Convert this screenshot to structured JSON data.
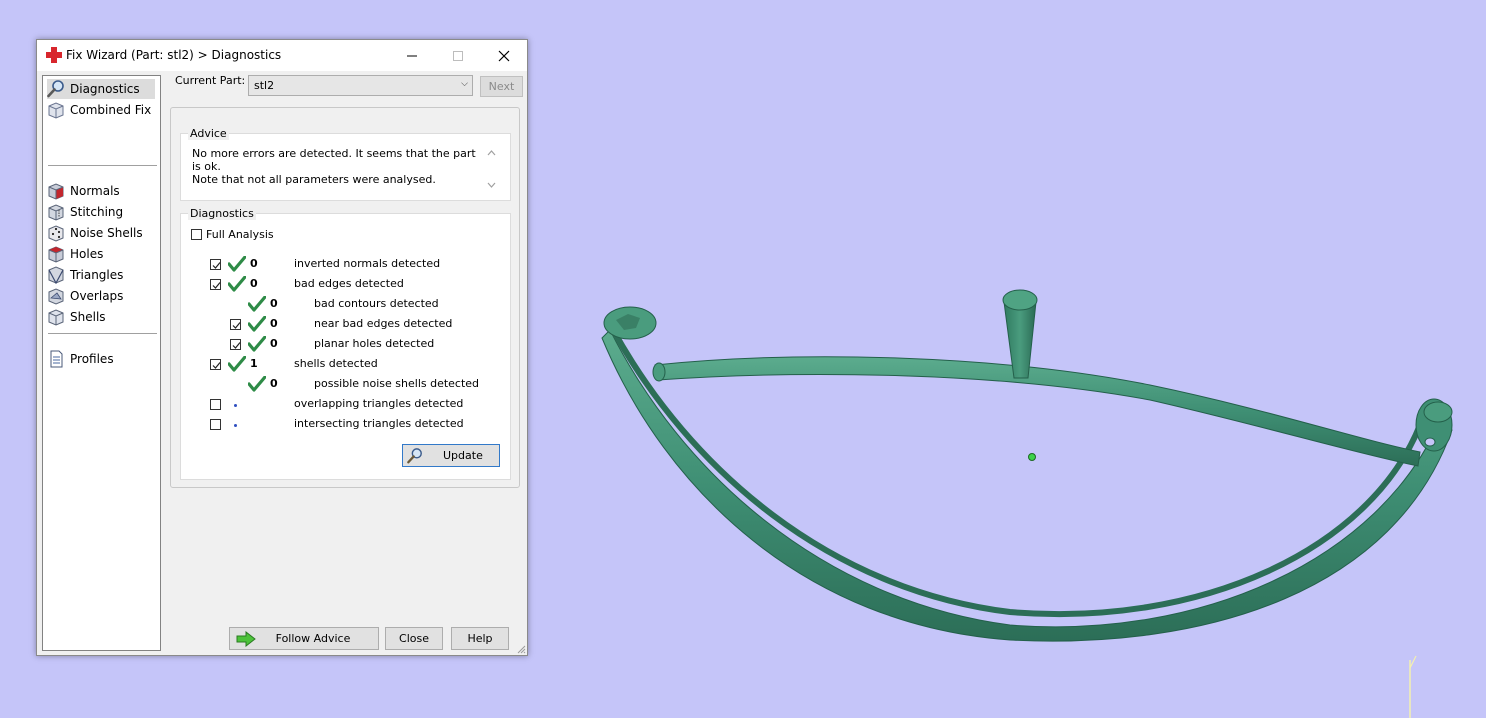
{
  "window": {
    "title": "Fix Wizard (Part: stl2) > Diagnostics",
    "minimize_icon": "minimize-icon",
    "maximize_icon": "maximize-icon",
    "close_icon": "close-icon"
  },
  "sidebar": {
    "items": [
      {
        "label": "Diagnostics",
        "icon": "magnifier-icon",
        "selected": true
      },
      {
        "label": "Combined Fix",
        "icon": "cube-icon"
      },
      {
        "label": "Normals",
        "icon": "normals-cube-icon"
      },
      {
        "label": "Stitching",
        "icon": "stitching-cube-icon"
      },
      {
        "label": "Noise Shells",
        "icon": "dice-icon"
      },
      {
        "label": "Holes",
        "icon": "holes-cube-icon"
      },
      {
        "label": "Triangles",
        "icon": "triangle-icon"
      },
      {
        "label": "Overlaps",
        "icon": "overlaps-icon"
      },
      {
        "label": "Shells",
        "icon": "shells-icon"
      },
      {
        "label": "Profiles",
        "icon": "document-icon"
      }
    ]
  },
  "current_part": {
    "label": "Current Part:",
    "value": "stl2",
    "next_label": "Next"
  },
  "advice": {
    "title": "Advice",
    "line1": "No more errors are detected. It seems that the part is ok.",
    "line2": "Note that not all parameters were analysed."
  },
  "diagnostics": {
    "title": "Diagnostics",
    "full_analysis_label": "Full Analysis",
    "full_analysis_checked": false,
    "rows": [
      {
        "count": "0",
        "label": "inverted normals detected",
        "checked": true,
        "status": "ok"
      },
      {
        "count": "0",
        "label": "bad edges detected",
        "checked": true,
        "status": "ok"
      },
      {
        "count": "0",
        "label": "bad contours detected",
        "status": "ok"
      },
      {
        "count": "0",
        "label": "near bad edges detected",
        "checked": true,
        "status": "ok"
      },
      {
        "count": "0",
        "label": "planar holes detected",
        "checked": true,
        "status": "ok"
      },
      {
        "count": "1",
        "label": "shells detected",
        "checked": true,
        "status": "ok"
      },
      {
        "count": "0",
        "label": "possible noise shells detected",
        "status": "ok"
      },
      {
        "count": "",
        "label": "overlapping triangles detected",
        "checked": false,
        "status": "pending"
      },
      {
        "count": "",
        "label": "intersecting triangles detected",
        "checked": false,
        "status": "pending"
      }
    ],
    "update_label": "Update"
  },
  "footer": {
    "follow_advice_label": "Follow Advice",
    "close_label": "Close",
    "help_label": "Help"
  },
  "colors": {
    "viewport_background": "#c5c5f9",
    "model": "#3f8f74",
    "check_green": "#2e8b47"
  }
}
